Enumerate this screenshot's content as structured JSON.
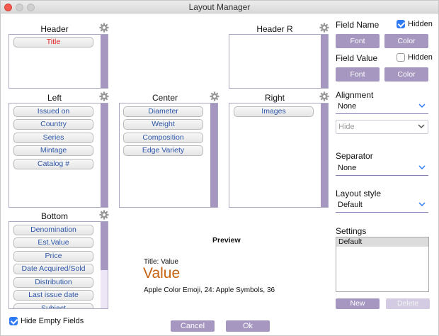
{
  "window": {
    "title": "Layout Manager"
  },
  "zones": {
    "header": {
      "title": "Header",
      "items": [
        "Title"
      ]
    },
    "header_r": {
      "title": "Header R",
      "items": []
    },
    "left": {
      "title": "Left",
      "items": [
        "Issued on",
        "Country",
        "Series",
        "Mintage",
        "Catalog #"
      ]
    },
    "center": {
      "title": "Center",
      "items": [
        "Diameter",
        "Weight",
        "Composition",
        "Edge Variety"
      ]
    },
    "right": {
      "title": "Right",
      "items": [
        "Images"
      ]
    },
    "bottom": {
      "title": "Bottom",
      "items": [
        "Denomination",
        "Est.Value",
        "Price",
        "Date Acquired/Sold",
        "Distribution",
        "Last issue date",
        "Subject"
      ]
    }
  },
  "preview": {
    "title": "Preview",
    "label_line": "Title: Value",
    "value": "Value",
    "font_line": "Apple Color Emoji, 24: Apple Symbols, 36"
  },
  "right_panel": {
    "field_name": {
      "label": "Field Name",
      "hidden_label": "Hidden",
      "hidden_checked": true,
      "font_btn": "Font",
      "color_btn": "Color"
    },
    "field_value": {
      "label": "Field Value",
      "hidden_label": "Hidden",
      "hidden_checked": false,
      "font_btn": "Font",
      "color_btn": "Color"
    },
    "alignment": {
      "label": "Alignment",
      "value": "None",
      "second_value": "Hide"
    },
    "separator": {
      "label": "Separator",
      "value": "None"
    },
    "layout_style": {
      "label": "Layout style",
      "value": "Default"
    },
    "settings": {
      "label": "Settings",
      "items": [
        "Default"
      ],
      "new_btn": "New",
      "delete_btn": "Delete"
    }
  },
  "footer": {
    "hide_empty_label": "Hide Empty Fields",
    "hide_empty_checked": true,
    "cancel_btn": "Cancel",
    "ok_btn": "Ok"
  },
  "colors": {
    "accent": "#a597c0",
    "close": "#f25a4f",
    "value_orange": "#c6620f",
    "chip_text": "#2d56a8",
    "title_chip": "#e02020"
  },
  "icons": {
    "gear": "gear-icon",
    "chevron": "chevron-down-icon",
    "check": "checkmark-icon"
  }
}
